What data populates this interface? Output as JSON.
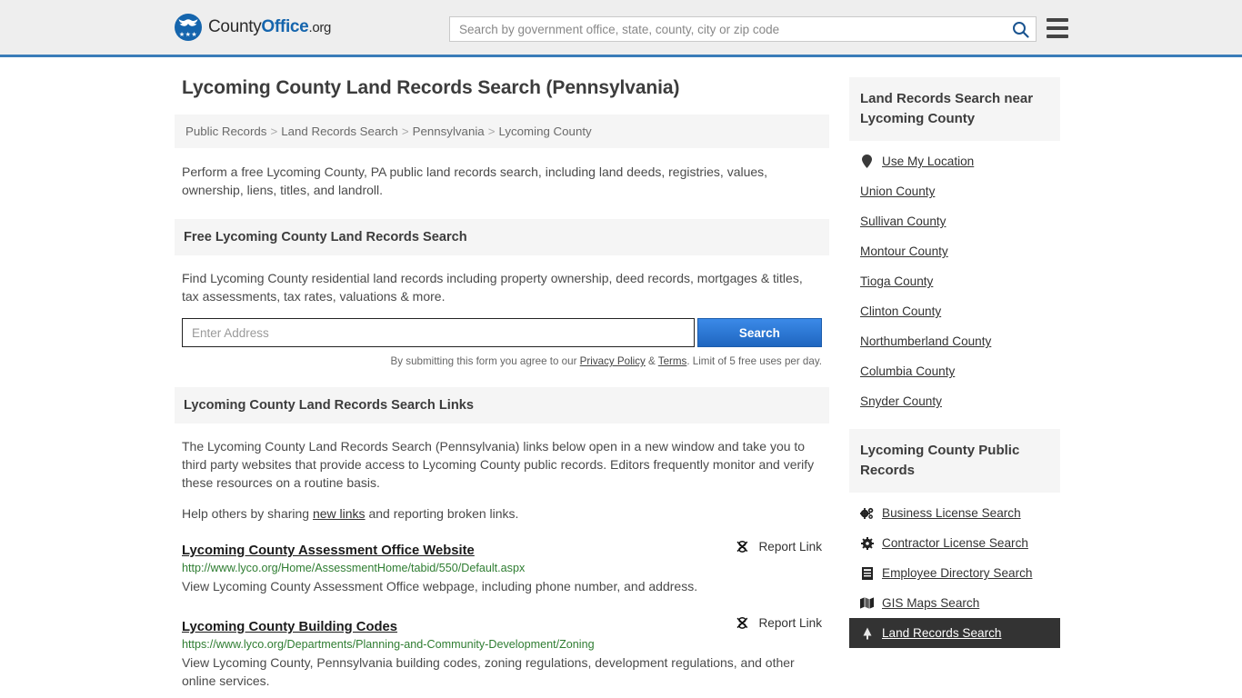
{
  "header": {
    "logo": {
      "part1": "County",
      "part2": "Office",
      "part3": ".org",
      "icon": "eagle-seal-icon",
      "stars": "★★★"
    },
    "search": {
      "placeholder": "Search by government office, state, county, city or zip code",
      "value": "",
      "icon": "search-icon"
    },
    "menu_icon": "hamburger-menu-icon",
    "brand_color": "#1565ad",
    "accent_border": "#3a7cb8"
  },
  "page": {
    "title": "Lycoming County Land Records Search (Pennsylvania)",
    "breadcrumb": [
      "Public Records",
      "Land Records Search",
      "Pennsylvania",
      "Lycoming County"
    ],
    "breadcrumb_separator": ">",
    "intro": "Perform a free Lycoming County, PA public land records search, including land deeds, registries, values, ownership, liens, titles, and landroll."
  },
  "free_search": {
    "heading": "Free Lycoming County Land Records Search",
    "body": "Find Lycoming County residential land records including property ownership, deed records, mortgages & titles, tax assessments, tax rates, valuations & more.",
    "input_placeholder": "Enter Address",
    "input_value": "",
    "button_label": "Search",
    "button_color": "#2878d8",
    "disclaimer_pre": "By submitting this form you agree to our ",
    "disclaimer_privacy": "Privacy Policy",
    "disclaimer_amp": " & ",
    "disclaimer_terms": "Terms",
    "disclaimer_post": ". Limit of 5 free uses per day."
  },
  "links_section": {
    "heading": "Lycoming County Land Records Search Links",
    "paragraph": "The Lycoming County Land Records Search (Pennsylvania) links below open in a new window and take you to third party websites that provide access to Lycoming County public records. Editors frequently monitor and verify these resources on a routine basis.",
    "help_pre": "Help others by sharing ",
    "help_link": "new links",
    "help_post": " and reporting broken links.",
    "report_label": "Report Link",
    "report_icon": "broken-link-icon",
    "results": [
      {
        "title": "Lycoming County Assessment Office Website",
        "url": "http://www.lyco.org/Home/AssessmentHome/tabid/550/Default.aspx",
        "description": "View Lycoming County Assessment Office webpage, including phone number, and address."
      },
      {
        "title": "Lycoming County Building Codes",
        "url": "https://www.lyco.org/Departments/Planning-and-Community-Development/Zoning",
        "description": "View Lycoming County, Pennsylvania building codes, zoning regulations, development regulations, and other online services."
      }
    ],
    "url_color": "#2f7d32"
  },
  "sidebar": {
    "nearby": {
      "heading": "Land Records Search near Lycoming County",
      "items": [
        {
          "label": "Use My Location",
          "icon": "map-pin-icon"
        },
        {
          "label": "Union County",
          "icon": ""
        },
        {
          "label": "Sullivan County",
          "icon": ""
        },
        {
          "label": "Montour County",
          "icon": ""
        },
        {
          "label": "Tioga County",
          "icon": ""
        },
        {
          "label": "Clinton County",
          "icon": ""
        },
        {
          "label": "Northumberland County",
          "icon": ""
        },
        {
          "label": "Columbia County",
          "icon": ""
        },
        {
          "label": "Snyder County",
          "icon": ""
        }
      ]
    },
    "public_records": {
      "heading": "Lycoming County Public Records",
      "items": [
        {
          "label": "Business License Search",
          "icon": "gears-icon",
          "active": false
        },
        {
          "label": "Contractor License Search",
          "icon": "gear-icon",
          "active": false
        },
        {
          "label": "Employee Directory Search",
          "icon": "document-list-icon",
          "active": false
        },
        {
          "label": "GIS Maps Search",
          "icon": "map-icon",
          "active": false
        },
        {
          "label": "Land Records Search",
          "icon": "tree-icon",
          "active": true
        }
      ],
      "active_bg": "#333333"
    }
  }
}
